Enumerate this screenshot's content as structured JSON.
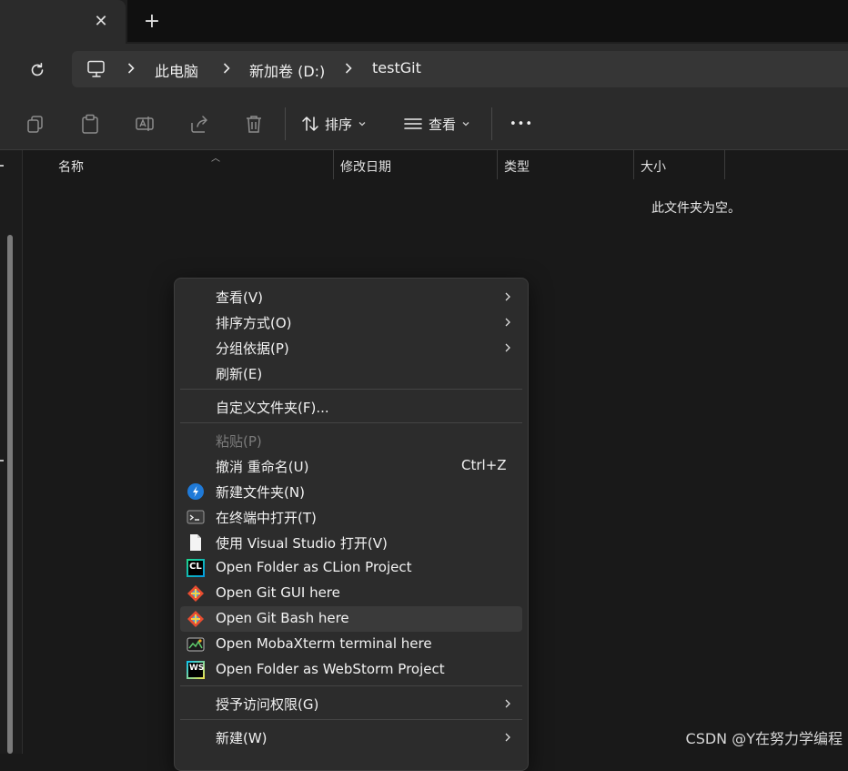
{
  "tabbar": {
    "close_glyph": "✕",
    "new_tab_glyph": "+"
  },
  "address": {
    "icons": [
      "refresh-icon",
      "computer-icon",
      "chevron-right-icon"
    ],
    "crumbs": [
      "此电脑",
      "新加卷 (D:)",
      "testGit"
    ]
  },
  "toolbar": {
    "icons": [
      "copy-icon",
      "paste-icon",
      "rename-icon",
      "share-icon",
      "delete-icon"
    ],
    "sort_label": "排序",
    "view_label": "查看",
    "more_label": "•••"
  },
  "columns": {
    "name": "名称",
    "date": "修改日期",
    "type": "类型",
    "size": "大小"
  },
  "empty_text": "此文件夹为空。",
  "context_menu": {
    "items": [
      {
        "label": "查看(V)",
        "submenu": true
      },
      {
        "label": "排序方式(O)",
        "submenu": true
      },
      {
        "label": "分组依据(P)",
        "submenu": true
      },
      {
        "label": "刷新(E)"
      },
      {
        "label": "自定义文件夹(F)..."
      },
      {
        "label": "粘贴(P)",
        "disabled": true
      },
      {
        "label": "撤消 重命名(U)",
        "shortcut": "Ctrl+Z"
      },
      {
        "label": "新建文件夹(N)",
        "icon": "new-folder-icon"
      },
      {
        "label": "在终端中打开(T)",
        "icon": "terminal-icon"
      },
      {
        "label": "使用 Visual Studio 打开(V)",
        "icon": "document-icon"
      },
      {
        "label": "Open Folder as CLion Project",
        "icon": "clion-icon",
        "icon_text": "CL"
      },
      {
        "label": "Open Git GUI here",
        "icon": "git-icon"
      },
      {
        "label": "Open Git Bash here",
        "icon": "git-icon",
        "hovered": true
      },
      {
        "label": "Open MobaXterm terminal here",
        "icon": "mobaxterm-icon"
      },
      {
        "label": "Open Folder as WebStorm Project",
        "icon": "webstorm-icon",
        "icon_text": "WS"
      },
      {
        "label": "授予访问权限(G)",
        "submenu": true
      },
      {
        "label": "新建(W)",
        "submenu": true
      }
    ]
  },
  "watermark": "CSDN @Y在努力学编程",
  "colors": {
    "background": "#191919",
    "menu": "#2c2c2c",
    "accent": "#0a84ff"
  }
}
